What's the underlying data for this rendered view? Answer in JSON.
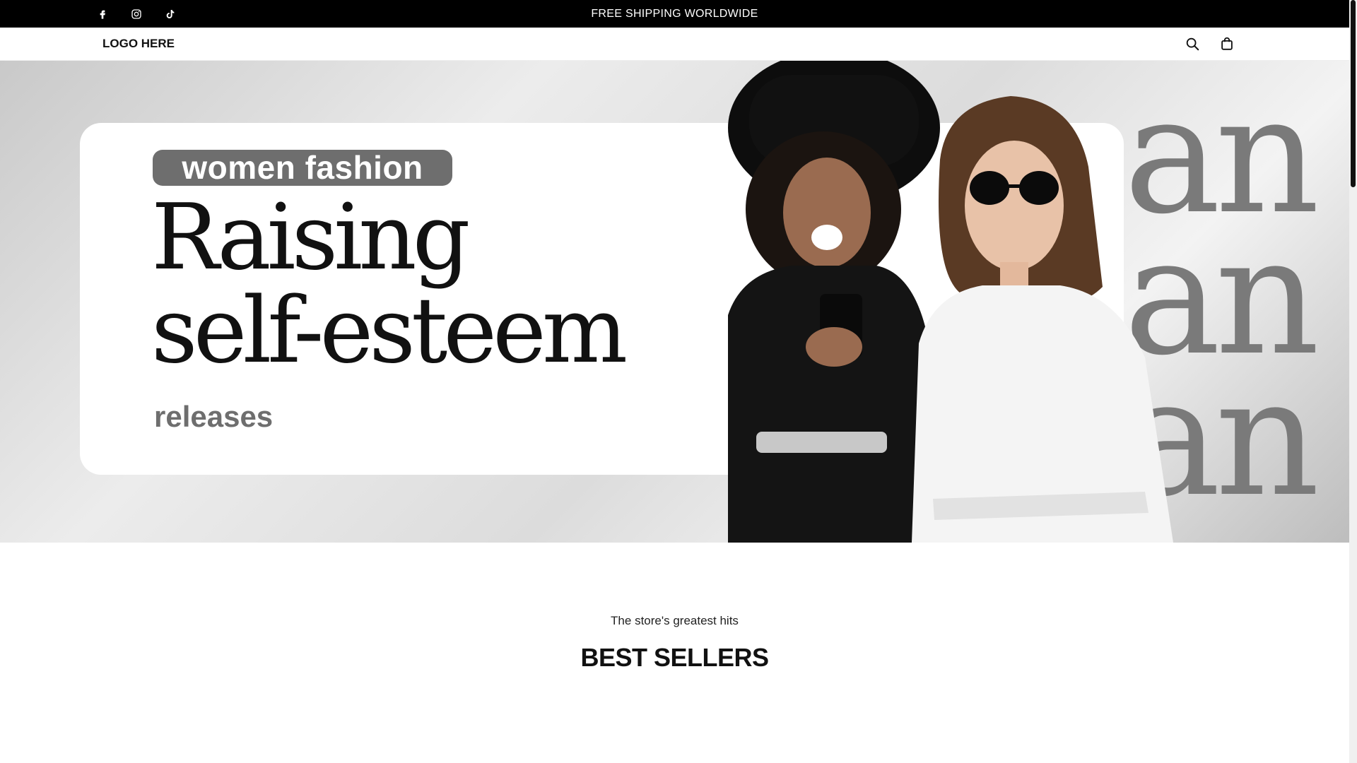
{
  "announcement": {
    "text": "FREE SHIPPING WORLDWIDE",
    "social": [
      "facebook-icon",
      "instagram-icon",
      "tiktok-icon"
    ]
  },
  "header": {
    "logo": "LOGO HERE",
    "icons": [
      "search-icon",
      "bag-icon"
    ]
  },
  "hero": {
    "badge": "women fashion",
    "headline_line1": "Raising",
    "headline_line2": "self-esteem",
    "tagline": "releases",
    "background_word": "an"
  },
  "section": {
    "subtitle": "The store's greatest hits",
    "title": "BEST SELLERS"
  },
  "colors": {
    "announcement_bg": "#000000",
    "badge_bg": "#6e6e6e",
    "text": "#111111"
  }
}
